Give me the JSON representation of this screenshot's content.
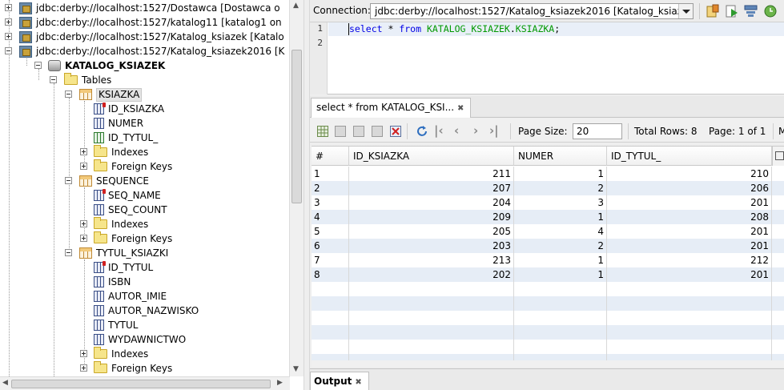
{
  "tree": {
    "connections": [
      "jdbc:derby://localhost:1527/Dostawca [Dostawca o",
      "jdbc:derby://localhost:1527/katalog11 [katalog1 on",
      "jdbc:derby://localhost:1527/Katalog_ksiazek [Katalo",
      "jdbc:derby://localhost:1527/Katalog_ksiazek2016 [K"
    ],
    "schema": "KATALOG_KSIAZEK",
    "tables_folder": "Tables",
    "tables": [
      {
        "name": "KSIAZKA",
        "columns": [
          "ID_KSIAZKA",
          "NUMER",
          "ID_TYTUL_"
        ]
      },
      {
        "name": "SEQUENCE",
        "columns": [
          "SEQ_NAME",
          "SEQ_COUNT"
        ]
      },
      {
        "name": "TYTUL_KSIAZKI",
        "columns": [
          "ID_TYTUL",
          "ISBN",
          "AUTOR_IMIE",
          "AUTOR_NAZWISKO",
          "TYTUL",
          "WYDAWNICTWO"
        ]
      }
    ],
    "indexes_label": "Indexes",
    "foreign_keys_label": "Foreign Keys"
  },
  "connection_bar": {
    "label": "Connection:",
    "selected": "jdbc:derby://localhost:1527/Katalog_ksiazek2016 [Katalog_ksiaz...",
    "icons": [
      "run-sql-icon",
      "run-statement-icon",
      "execute-icon",
      "history-icon"
    ]
  },
  "editor": {
    "line_numbers": [
      "1",
      "2"
    ],
    "code": {
      "kw1": "select",
      "star": " * ",
      "kw2": "from",
      "schema": "KATALOG_KSIAZEK",
      "dot": ".",
      "table": "KSIAZKA",
      "semi": ";"
    }
  },
  "results": {
    "tab_label": "select * from KATALOG_KSI...",
    "tab_close": "✖",
    "page_size_label": "Page Size:",
    "page_size_value": "20",
    "total_rows": "Total Rows: 8",
    "page_info": "Page: 1 of 1",
    "page_info_cut": "M",
    "columns": [
      "#",
      "ID_KSIAZKA",
      "NUMER",
      "ID_TYTUL_"
    ],
    "rows": [
      [
        "1",
        "211",
        "1",
        "210"
      ],
      [
        "2",
        "207",
        "2",
        "206"
      ],
      [
        "3",
        "204",
        "3",
        "201"
      ],
      [
        "4",
        "209",
        "1",
        "208"
      ],
      [
        "5",
        "205",
        "4",
        "201"
      ],
      [
        "6",
        "203",
        "2",
        "201"
      ],
      [
        "7",
        "213",
        "1",
        "212"
      ],
      [
        "8",
        "202",
        "1",
        "201"
      ]
    ]
  },
  "output": {
    "tab_label": "Output",
    "tab_close": "✖"
  },
  "colors": {
    "keyword": "#0000e6",
    "identifier": "#009900",
    "row_alt": "#e6edf6"
  }
}
